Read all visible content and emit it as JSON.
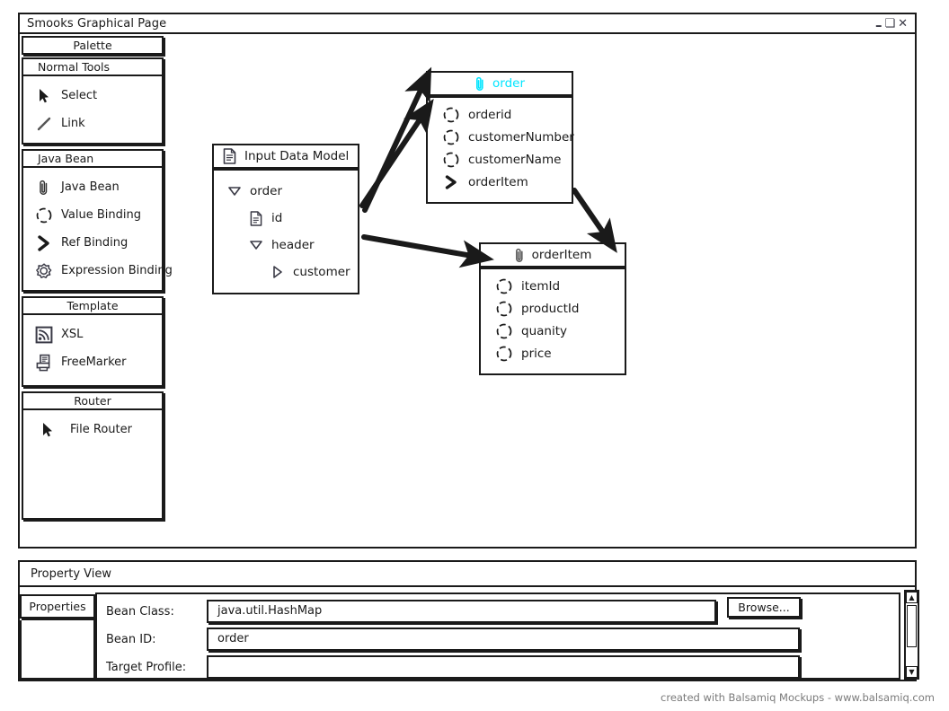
{
  "window": {
    "title": "Smooks Graphical Page",
    "controls": [
      {
        "name": "minimize",
        "glyph": "–"
      },
      {
        "name": "maximize",
        "glyph": "❏"
      },
      {
        "name": "close",
        "glyph": "✕"
      }
    ]
  },
  "palette": {
    "title": "Palette",
    "sections": [
      {
        "header": "Normal Tools",
        "items": [
          {
            "label": "Select",
            "icon": "cursor-arrow-icon"
          },
          {
            "label": "Link",
            "icon": "link-line-icon"
          }
        ]
      },
      {
        "header": "Java Bean",
        "items": [
          {
            "label": "Java Bean",
            "icon": "paperclip-icon"
          },
          {
            "label": "Value Binding",
            "icon": "dashed-circle-icon"
          },
          {
            "label": "Ref Binding",
            "icon": "chevron-right-icon"
          },
          {
            "label": "Expression Binding",
            "icon": "gear-icon"
          }
        ]
      },
      {
        "header": "Template",
        "items": [
          {
            "label": "XSL",
            "icon": "rss-feed-icon"
          },
          {
            "label": "FreeMarker",
            "icon": "printer-document-icon"
          }
        ]
      },
      {
        "header": "Router",
        "items": [
          {
            "label": "File Router",
            "icon": "cursor-arrow-icon"
          }
        ]
      }
    ]
  },
  "canvas": {
    "input_data_model": {
      "title": "Input Data Model",
      "title_icon": "document-icon",
      "tree": [
        {
          "label": "order",
          "icon": "triangle-down-icon",
          "indent": 0
        },
        {
          "label": "id",
          "icon": "document-icon",
          "indent": 1
        },
        {
          "label": "header",
          "icon": "triangle-down-icon",
          "indent": 1
        },
        {
          "label": "customer",
          "icon": "triangle-right-icon",
          "indent": 2
        }
      ]
    },
    "order_node": {
      "title": "order",
      "title_icon": "paperclip-icon",
      "title_color": "#00e5ff",
      "rows": [
        {
          "label": "orderid",
          "icon": "dashed-circle-icon"
        },
        {
          "label": "customerNumber",
          "icon": "dashed-circle-icon"
        },
        {
          "label": "customerName",
          "icon": "dashed-circle-icon"
        },
        {
          "label": "orderItem",
          "icon": "chevron-right-icon"
        }
      ]
    },
    "order_item_node": {
      "title": "orderItem",
      "title_icon": "paperclip-icon",
      "title_color": "#1a1a1a",
      "rows": [
        {
          "label": "itemId",
          "icon": "dashed-circle-icon"
        },
        {
          "label": "productId",
          "icon": "dashed-circle-icon"
        },
        {
          "label": "quanity",
          "icon": "dashed-circle-icon"
        },
        {
          "label": "price",
          "icon": "dashed-circle-icon"
        }
      ]
    },
    "connections": [
      {
        "from": "input-data-model",
        "to": "order-node",
        "name": "arrow-model-to-order-1"
      },
      {
        "from": "input-data-model",
        "to": "order-node",
        "name": "arrow-model-to-order-2"
      },
      {
        "from": "input-data-model",
        "to": "order-item-node",
        "name": "arrow-model-to-orderitem"
      },
      {
        "from": "order-node",
        "to": "order-item-node",
        "name": "arrow-order-to-orderitem"
      }
    ]
  },
  "property_view": {
    "title": "Property View",
    "tab": "Properties",
    "fields": [
      {
        "label": "Bean Class:",
        "value": "java.util.HashMap",
        "placeholder": ""
      },
      {
        "label": "Bean ID:",
        "value": "order",
        "placeholder": ""
      },
      {
        "label": "Target Profile:",
        "value": "",
        "placeholder": ""
      }
    ],
    "browse_button": "Browse..."
  },
  "footer": {
    "credit": "created with Balsamiq Mockups - www.balsamiq.com"
  }
}
